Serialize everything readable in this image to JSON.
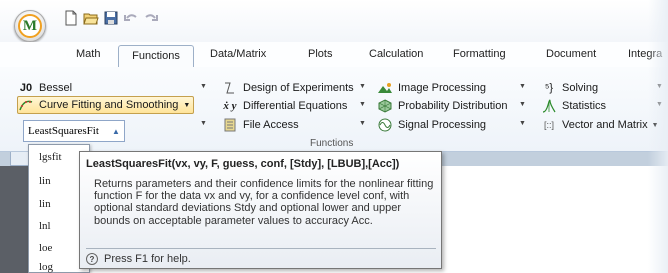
{
  "app": {
    "logo_letter": "M"
  },
  "tabs": [
    "Math",
    "Functions",
    "Data/Matrix",
    "Plots",
    "Calculation",
    "Formatting",
    "Document",
    "Integra"
  ],
  "ribbon": {
    "col1": [
      {
        "icon": "J0",
        "label": "Bessel"
      },
      {
        "label": "Curve Fitting and Smoothing"
      }
    ],
    "col2": [
      {
        "label": "Design of Experiments"
      },
      {
        "icon": "ẋ y",
        "label": "Differential Equations"
      },
      {
        "label": "File Access"
      }
    ],
    "col3": [
      {
        "label": "Image Processing"
      },
      {
        "label": "Probability Distribution"
      },
      {
        "label": "Signal Processing"
      }
    ],
    "col4": [
      {
        "icon": "⁵}",
        "label": "Solving"
      },
      {
        "label": "Statistics"
      },
      {
        "icon": "[::]",
        "label": "Vector and Matrix"
      }
    ],
    "group_label": "Functions"
  },
  "combo": {
    "value": "LeastSquaresFit"
  },
  "dropdown_items": [
    "lgsfit",
    "lin",
    "lin",
    "lnl",
    "loe",
    "log"
  ],
  "tooltip": {
    "title": "LeastSquaresFit(vx, vy, F, guess, conf, [Stdy], [LBUB],[Acc])",
    "body": "Returns parameters and their confidence limits for the nonlinear fitting function F for the data vx and vy, for a confidence level conf, with optional standard deviations Stdy and optional lower and upper bounds on acceptable parameter values to accuracy Acc.",
    "help": "Press F1 for help."
  }
}
